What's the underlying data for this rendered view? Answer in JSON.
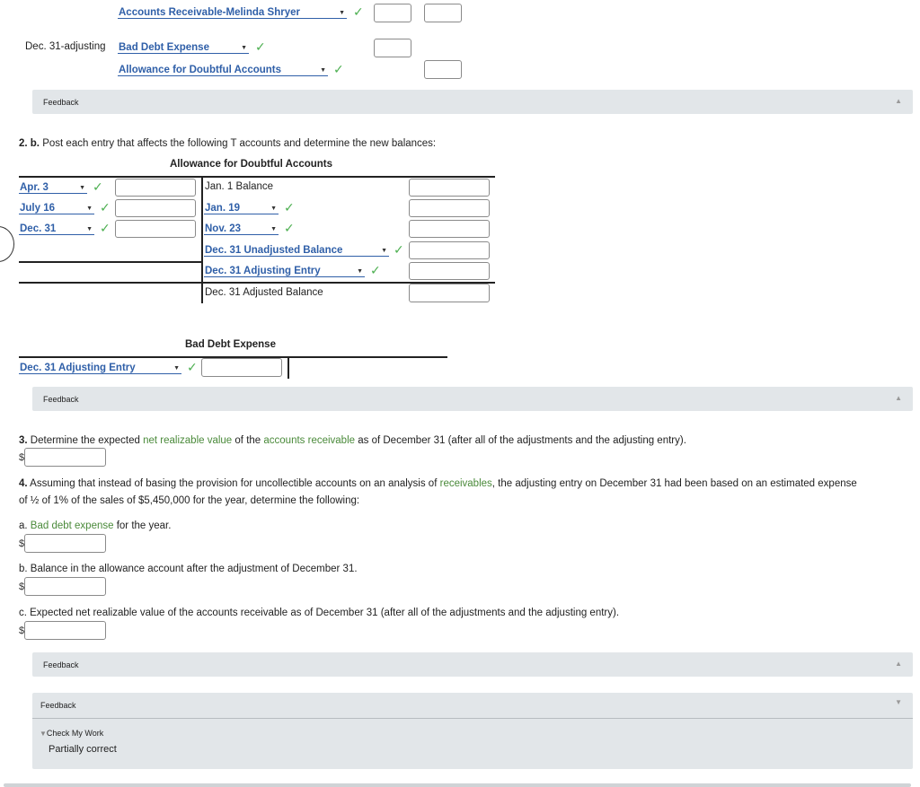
{
  "journal": {
    "row1_select": "Accounts Receivable-Melinda Shryer",
    "row2_date": "Dec. 31-adjusting",
    "row2_select": "Bad Debt Expense",
    "row3_select": "Allowance for Doubtful Accounts"
  },
  "feedback_label": "Feedback",
  "part2b": {
    "num": "2. b.",
    "instruction": "Post each entry that affects the following T accounts and determine the new balances:",
    "allowance_title": "Allowance for Doubtful Accounts",
    "left_rows": [
      "Apr. 3",
      "July 16",
      "Dec. 31"
    ],
    "right_static_1": "Jan. 1 Balance",
    "right_select_1": "Jan. 19",
    "right_select_2": "Nov. 23",
    "right_select_3": "Dec. 31 Unadjusted Balance",
    "right_select_4": "Dec. 31 Adjusting Entry",
    "right_static_2": "Dec. 31 Adjusted Balance",
    "bad_debt_title": "Bad Debt Expense",
    "bad_debt_select": "Dec. 31 Adjusting Entry"
  },
  "part3": {
    "num": "3.",
    "text_a": "Determine the expected",
    "link1": "net realizable value",
    "text_b": "of the",
    "link2": "accounts receivable",
    "text_c": "as of December 31 (after all of the adjustments and the adjusting entry).",
    "currency": "$"
  },
  "part4": {
    "num": "4.",
    "text_a": "Assuming that instead of basing the provision for uncollectible accounts on an analysis of",
    "link1": "receivables",
    "text_b": ", the adjusting entry on December 31 had been based on an estimated expense",
    "line2": "of ½ of 1% of the sales of $5,450,000 for the year, determine the following:",
    "a_prefix": "a.",
    "a_link": "Bad debt expense",
    "a_suffix": "for the year.",
    "b_text": "b.  Balance in the allowance account after the adjustment of December 31.",
    "c_text": "c.  Expected net realizable value of the accounts receivable as of December 31 (after all of the adjustments and the adjusting entry).",
    "currency": "$"
  },
  "check": {
    "label": "Check My Work",
    "status": "Partially correct"
  }
}
